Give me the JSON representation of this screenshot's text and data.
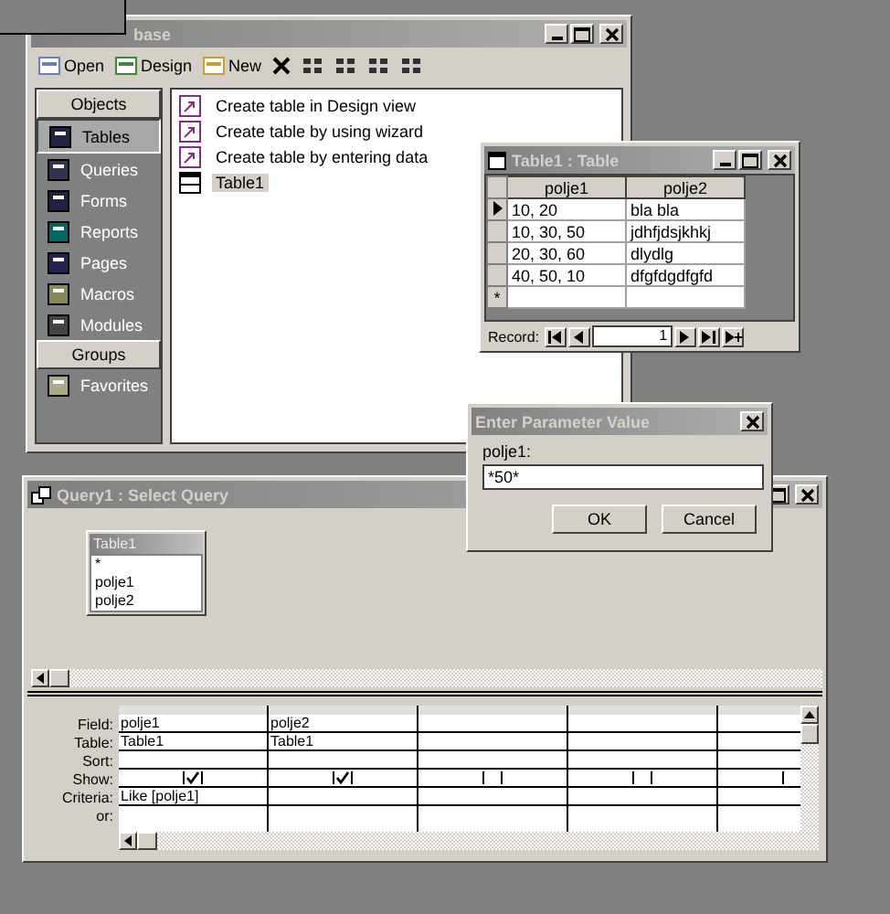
{
  "database_window": {
    "title": "base",
    "toolbar": [
      {
        "kind": "open",
        "label": "Open"
      },
      {
        "kind": "design",
        "label": "Design"
      },
      {
        "kind": "new",
        "label": "New"
      },
      {
        "kind": "delete"
      },
      {
        "kind": "large-icons"
      },
      {
        "kind": "small-icons"
      },
      {
        "kind": "list"
      },
      {
        "kind": "details"
      }
    ],
    "sidebar": [
      {
        "header": "Objects",
        "items": [
          {
            "label": "Tables",
            "selected": true
          },
          {
            "label": "Queries",
            "selected": false
          },
          {
            "label": "Forms",
            "selected": false
          },
          {
            "label": "Reports",
            "selected": false
          },
          {
            "label": "Pages",
            "selected": false
          },
          {
            "label": "Macros",
            "selected": false
          },
          {
            "label": "Modules",
            "selected": false
          }
        ]
      },
      {
        "header": "Groups",
        "items": [
          {
            "label": "Favorites",
            "selected": false
          }
        ]
      }
    ],
    "items": [
      {
        "kind": "shortcut",
        "label": "Create table in Design view",
        "selected": false
      },
      {
        "kind": "shortcut",
        "label": "Create table by using wizard",
        "selected": false
      },
      {
        "kind": "shortcut",
        "label": "Create table by entering data",
        "selected": false
      },
      {
        "kind": "table",
        "label": "Table1",
        "selected": true
      }
    ]
  },
  "table_window": {
    "title": "Table1 : Table",
    "columns": [
      "polje1",
      "polje2"
    ],
    "rows": [
      {
        "current": true,
        "cells": [
          "10, 20",
          "bla bla"
        ]
      },
      {
        "current": false,
        "cells": [
          "10, 30, 50",
          "jdhfjdsjkhkj"
        ]
      },
      {
        "current": false,
        "cells": [
          "20, 30, 60",
          "dlydlg"
        ]
      },
      {
        "current": false,
        "cells": [
          "40, 50, 10",
          "dfgfdgdfgfd"
        ]
      }
    ],
    "new_row_marker": "*",
    "record_label": "Record:",
    "record_value": "1"
  },
  "parameter_dialog": {
    "title": "Enter Parameter Value",
    "prompt": "polje1:",
    "value": "*50*",
    "buttons": [
      "OK",
      "Cancel"
    ]
  },
  "query_window": {
    "title": "Query1 : Select Query",
    "field_list": {
      "title": "Table1",
      "fields": [
        "*",
        "polje1",
        "polje2"
      ]
    },
    "row_labels": [
      "Field:",
      "Table:",
      "Sort:",
      "Show:",
      "Criteria:",
      "or:"
    ],
    "columns": [
      {
        "field": "polje1",
        "table": "Table1",
        "show": true,
        "criteria": "Like [polje1]"
      },
      {
        "field": "polje2",
        "table": "Table1",
        "show": true
      },
      {
        "show": false
      },
      {
        "show": false
      },
      {
        "show": false
      }
    ]
  }
}
